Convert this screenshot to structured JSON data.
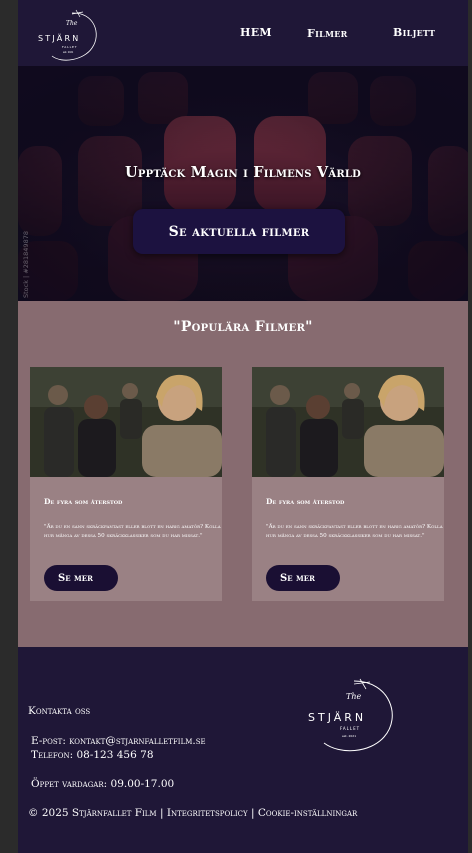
{
  "brand": {
    "logo_lines": [
      "The",
      "STJÄRN",
      "FALLET",
      "est. 2021"
    ]
  },
  "nav": {
    "items": [
      "HEM",
      "Filmer",
      "Biljett"
    ]
  },
  "hero": {
    "title": "Upptäck Magin i Filmens Värld",
    "button_label": "Se aktuella filmer",
    "stock_watermark": "Stock | #281849878"
  },
  "popular": {
    "title": "\"Populära Filmer\"",
    "cards": [
      {
        "title": "De fyra som återstod",
        "description": "\"Är du en sann skräckfantast eller blott en harig amatör? Kolla hur många av dessa 50 skräckklassiker som du har missat.\"",
        "button_label": "Se mer"
      },
      {
        "title": "De fyra som återstod",
        "description": "\"Är du en sann skräckfantast eller blott en harig amatör? Kolla hur många av dessa 50 skräckklassiker som du har missat.\"",
        "button_label": "Se mer"
      }
    ]
  },
  "footer": {
    "contact_heading": "Kontakta oss",
    "email": "E-post: kontakt@stjarnfalletfilm.se",
    "phone": "Telefon: 08-123 456 78",
    "hours": "Öppet vardagar: 09.00-17.00",
    "copyright": "© 2025 Stjärnfallet Film",
    "privacy_link": "Integritetspolicy",
    "cookie_link": "Cookie-inställningar",
    "separator": "|"
  },
  "colors": {
    "page_bg": "#1f1737",
    "popular_bg": "#876b70",
    "card_bg": "#9a8184",
    "button_bg": "#1a0f33"
  }
}
